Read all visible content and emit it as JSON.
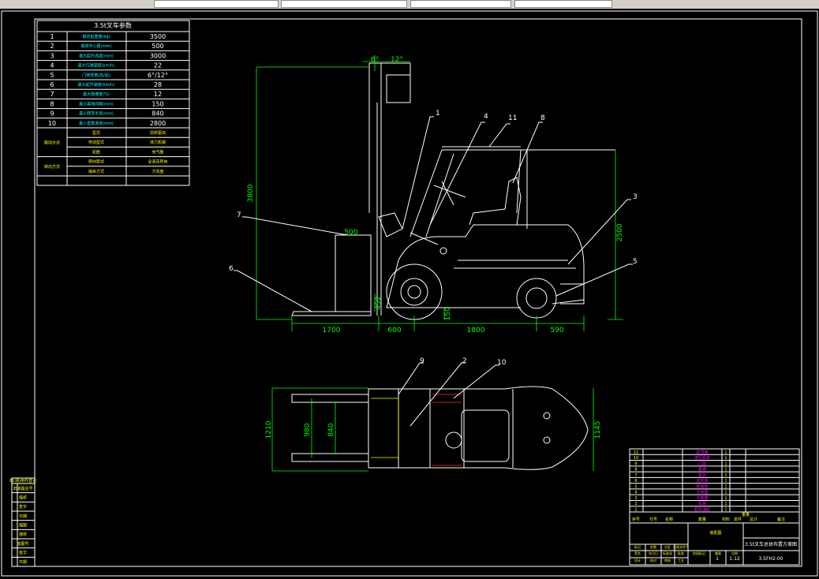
{
  "spec_table": {
    "title": "3.5t叉车参数",
    "rows": [
      {
        "no": "1",
        "name": "额定起重量(kg)",
        "value": "3500"
      },
      {
        "no": "2",
        "name": "载荷中心距(mm)",
        "value": "500"
      },
      {
        "no": "3",
        "name": "最大起升高度(mm)",
        "value": "3000"
      },
      {
        "no": "4",
        "name": "最大行驶速度(km/h)",
        "value": "22"
      },
      {
        "no": "5",
        "name": "门架倾角(前/后)",
        "value": "6°/12°"
      },
      {
        "no": "6",
        "name": "最大起升速度(km/h)",
        "value": "28"
      },
      {
        "no": "7",
        "name": "最大爬坡度(%)",
        "value": "12"
      },
      {
        "no": "8",
        "name": "最小离地间隙(mm)",
        "value": "150"
      },
      {
        "no": "9",
        "name": "最小转弯半径(mm)",
        "value": "840"
      },
      {
        "no": "10",
        "name": "最小直角通道(mm)",
        "value": "2800"
      }
    ],
    "groups": [
      {
        "label": "驱动方式",
        "items": [
          {
            "name": "型式",
            "value": "前桥驱动"
          },
          {
            "name": "传动型式",
            "value": "液力机械"
          },
          {
            "name": "轮胎",
            "value": "充气胎"
          }
        ]
      },
      {
        "label": "转向方式",
        "items": [
          {
            "name": "转向型式",
            "value": "全液压转向"
          },
          {
            "name": "操纵方式",
            "value": "方向盘"
          }
        ]
      }
    ]
  },
  "side_view": {
    "leaders": [
      "1",
      "4",
      "11",
      "8",
      "3",
      "5",
      "7",
      "6"
    ],
    "dims": {
      "height": "3800",
      "overall_height": "2500",
      "fork_length": "1700",
      "front_overhang": "600",
      "wheelbase": "1800",
      "rear_overhang": "590",
      "load_width": "500",
      "tilt_front": "6°",
      "tilt_back": "12°",
      "clearance": "150",
      "wheel_h": "452"
    }
  },
  "top_view": {
    "leaders": [
      "9",
      "2",
      "10"
    ],
    "dims": {
      "outer_width": "1210",
      "fork_spread": "980",
      "inner_spread": "840",
      "body_width": "1145"
    }
  },
  "left_strip": {
    "title": "借(通)用件登记",
    "rows": [
      "旧底图总号",
      "描校",
      "签字",
      "日期",
      "描图",
      "描校",
      "底图号",
      "签字",
      "日期"
    ]
  },
  "bom": {
    "rows": [
      {
        "no": "11",
        "name": "护顶架",
        "qty": "1"
      },
      {
        "no": "10",
        "name": "液压系统",
        "qty": "1"
      },
      {
        "no": "9",
        "name": "门架",
        "qty": "1"
      },
      {
        "no": "8",
        "name": "座椅",
        "qty": "1"
      },
      {
        "no": "7",
        "name": "货叉",
        "qty": "1"
      },
      {
        "no": "6",
        "name": "货叉架",
        "qty": "1"
      },
      {
        "no": "5",
        "name": "转向桥",
        "qty": "1"
      },
      {
        "no": "4",
        "name": "方向盘",
        "qty": "1"
      },
      {
        "no": "3",
        "name": "平衡重",
        "qty": "1"
      },
      {
        "no": "2",
        "name": "车架",
        "qty": "1"
      },
      {
        "no": "1",
        "name": "起升油缸",
        "qty": "1"
      }
    ],
    "header": [
      "序号",
      "代号",
      "名称",
      "数量",
      "材料",
      "单件",
      "总计",
      "备注"
    ],
    "header_sub": [
      "重量"
    ]
  },
  "title_block": {
    "assembly": "装配图",
    "drawing_title": "3.5t叉车总体布置方案图",
    "scale": "1:12",
    "sheet": "1",
    "code": "3.5FH2-00",
    "labels": [
      "标记",
      "处数",
      "分区",
      "更改文件号",
      "签名",
      "年月日",
      "设计",
      "校对",
      "审核",
      "工艺",
      "标准化",
      "批准",
      "阶段标记",
      "重量",
      "比例"
    ]
  },
  "colors": {
    "lines": "#ffffff",
    "dims": "#00ff00",
    "red": "#ff3030",
    "yellow": "#ffff00",
    "cyan": "#00ffff",
    "magenta": "#ff00ff",
    "background": "#000000"
  }
}
